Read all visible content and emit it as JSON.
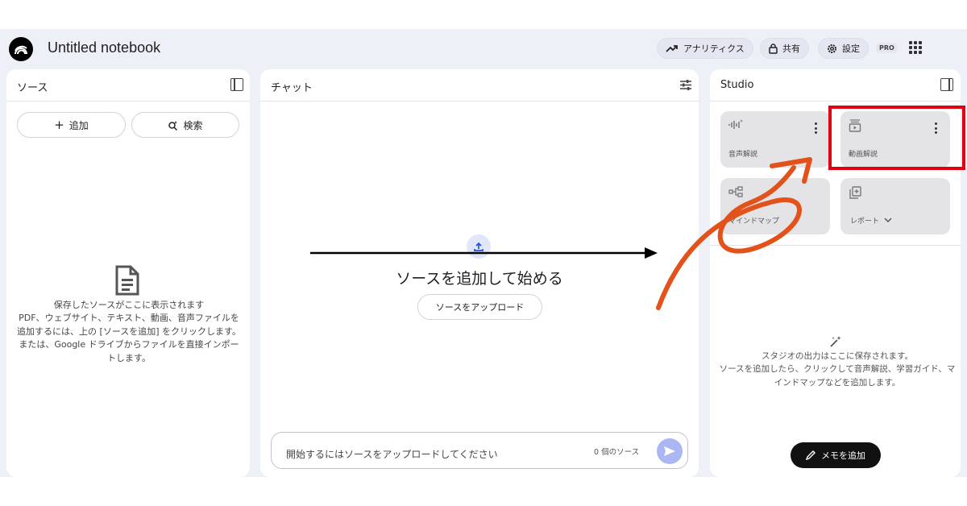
{
  "header": {
    "title": "Untitled notebook",
    "analytics_label": "アナリティクス",
    "share_label": "共有",
    "settings_label": "設定",
    "pro_badge": "PRO"
  },
  "sources": {
    "title": "ソース",
    "add_label": "追加",
    "search_label": "検索",
    "empty_line1": "保存したソースがここに表示されます",
    "empty_line2": "PDF、ウェブサイト、テキスト、動画、音声ファイルを追加するには、上の [ソースを追加] をクリックします。または、Google ドライブからファイルを直接インポートします。"
  },
  "chat": {
    "title": "チャット",
    "heading": "ソースを追加して始める",
    "upload_button": "ソースをアップロード",
    "input_placeholder": "開始するにはソースをアップロードしてください",
    "source_count": "0 個のソース"
  },
  "studio": {
    "title": "Studio",
    "tiles": [
      {
        "label": "音声解説",
        "icon": "audio-waveform-icon"
      },
      {
        "label": "動画解説",
        "icon": "video-play-icon"
      },
      {
        "label": "マインドマップ",
        "icon": "mind-map-icon"
      },
      {
        "label": "レポート",
        "icon": "report-icon"
      }
    ],
    "empty_line1": "スタジオの出力はここに保存されます。",
    "empty_line2": "ソースを追加したら、クリックして音声解説、学習ガイド、マインドマップなどを追加します。",
    "memo_button": "メモを追加"
  },
  "annotation": {
    "highlight_color": "#e0000f",
    "arrow_color": "#e2521a",
    "line_arrow_color": "#000000"
  }
}
